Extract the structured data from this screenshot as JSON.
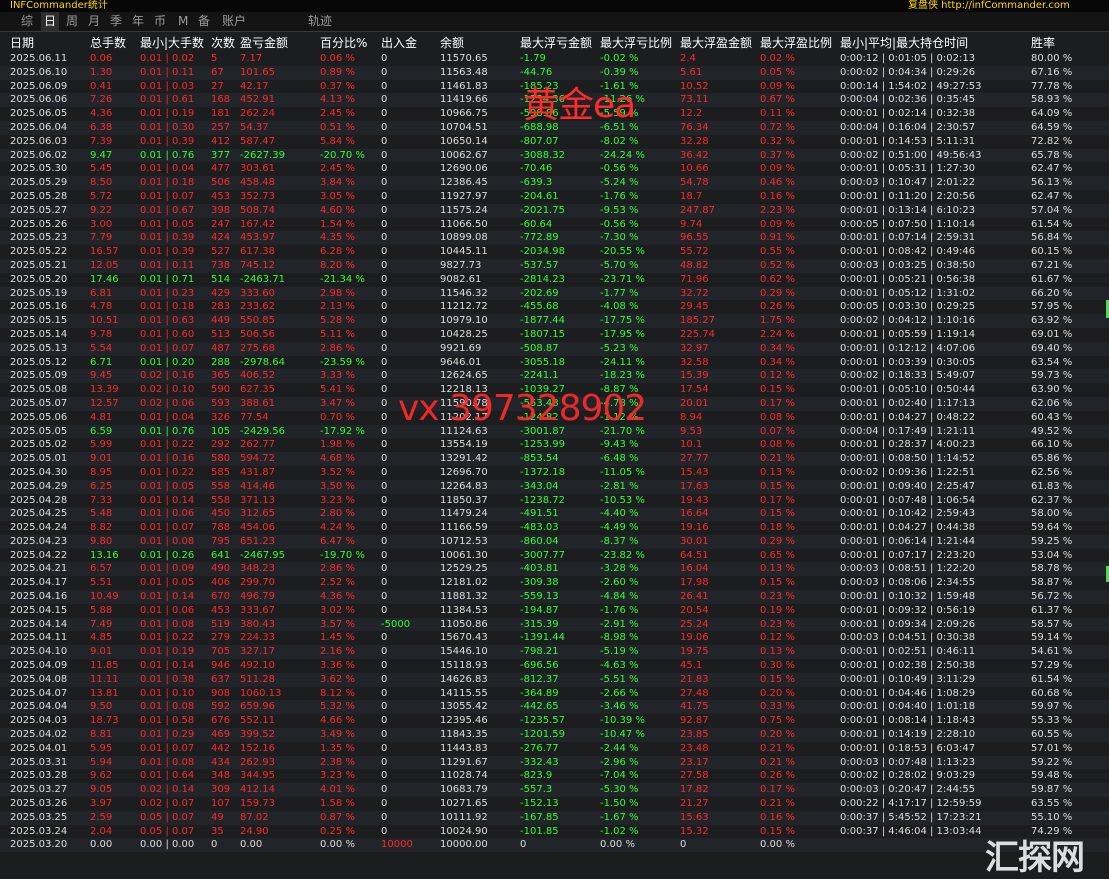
{
  "titlebar": {
    "left": "INFCommander统计",
    "right": "复盘侠 http://infCommander.com"
  },
  "tabs": [
    "综",
    "日",
    "周",
    "月",
    "季",
    "年",
    "币",
    "M",
    "备",
    "账户",
    "轨迹"
  ],
  "active_tab": "日",
  "headers": [
    "日期",
    "总手数",
    "最小|大手数",
    "次数",
    "盈亏金额",
    "百分比%",
    "出入金",
    "余额",
    "最大浮亏金额",
    "最大浮亏比例",
    "最大浮盈金额",
    "最大浮盈比例",
    "最小|平均|最大持仓时间",
    "胜率"
  ],
  "watermarks": {
    "gold": "黄金ea",
    "contact": "vx 397328902",
    "site": "汇探网"
  },
  "rows": [
    [
      "2025.06.11",
      "0.06",
      "0.01 | 0.02",
      "5",
      "7.17",
      "0.06 %",
      "0",
      "11570.65",
      "-1.79",
      "-0.02 %",
      "2.4",
      "0.02 %",
      "0:00:12 | 0:01:05 | 0:02:13",
      "80.00 %"
    ],
    [
      "2025.06.10",
      "1.30",
      "0.01 | 0.11",
      "67",
      "101.65",
      "0.89 %",
      "0",
      "11563.48",
      "-44.76",
      "-0.39 %",
      "5.61",
      "0.05 %",
      "0:00:02 | 0:04:34 | 0:29:26",
      "67.16 %"
    ],
    [
      "2025.06.09",
      "0.41",
      "0.01 | 0.03",
      "27",
      "42.17",
      "0.37 %",
      "0",
      "11461.83",
      "-185.23",
      "-1.61 %",
      "10.52",
      "0.09 %",
      "0:00:14 | 1:54:02 | 49:27:53",
      "77.78 %"
    ],
    [
      "2025.06.06",
      "7.26",
      "0.01 | 0.61",
      "168",
      "452.91",
      "4.13 %",
      "0",
      "11419.66",
      "-1234.36",
      "-11.26 %",
      "73.11",
      "0.67 %",
      "0:00:04 | 0:02:36 | 0:35:45",
      "58.93 %"
    ],
    [
      "2025.06.05",
      "4.36",
      "0.01 | 0.19",
      "181",
      "262.24",
      "2.45 %",
      "0",
      "10966.75",
      "-598.86",
      "-5.59 %",
      "12.2",
      "0.11 %",
      "0:00:01 | 0:02:14 | 0:32:38",
      "64.09 %"
    ],
    [
      "2025.06.04",
      "6.38",
      "0.01 | 0.30",
      "257",
      "54.37",
      "0.51 %",
      "0",
      "10704.51",
      "-688.98",
      "-6.51 %",
      "76.34",
      "0.72 %",
      "0:00:04 | 0:16:04 | 2:30:57",
      "64.59 %"
    ],
    [
      "2025.06.03",
      "7.39",
      "0.01 | 0.39",
      "412",
      "587.47",
      "5.84 %",
      "0",
      "10650.14",
      "-807.07",
      "-8.02 %",
      "32.28",
      "0.32 %",
      "0:00:01 | 0:14:53 | 5:11:31",
      "72.82 %"
    ],
    [
      "2025.06.02",
      "9.47",
      "0.01 | 0.76",
      "377",
      "-2627.39",
      "-20.70 %",
      "0",
      "10062.67",
      "-3088.32",
      "-24.24 %",
      "36.42",
      "0.37 %",
      "0:00:02 | 0:51:00 | 49:56:43",
      "65.78 %"
    ],
    [
      "2025.05.30",
      "5.45",
      "0.01 | 0.04",
      "477",
      "303.61",
      "2.45 %",
      "0",
      "12690.06",
      "-70.46",
      "-0.56 %",
      "10.66",
      "0.09 %",
      "0:00:01 | 0:05:31 | 1:27:30",
      "62.47 %"
    ],
    [
      "2025.05.29",
      "8.50",
      "0.01 | 0.18",
      "506",
      "458.48",
      "3.84 %",
      "0",
      "12386.45",
      "-639.3",
      "-5.24 %",
      "54.78",
      "0.46 %",
      "0:00:03 | 0:10:47 | 2:01:22",
      "56.13 %"
    ],
    [
      "2025.05.28",
      "5.72",
      "0.01 | 0.07",
      "453",
      "352.73",
      "3.05 %",
      "0",
      "11927.97",
      "-204.61",
      "-1.76 %",
      "18.7",
      "0.16 %",
      "0:00:01 | 0:11:20 | 2:20:56",
      "62.47 %"
    ],
    [
      "2025.05.27",
      "9.22",
      "0.01 | 0.67",
      "398",
      "508.74",
      "4.60 %",
      "0",
      "11575.24",
      "-2021.75",
      "-9.53 %",
      "247.87",
      "2.23 %",
      "0:00:01 | 0:13:14 | 6:10:23",
      "57.04 %"
    ],
    [
      "2025.05.26",
      "3.00",
      "0.01 | 0.05",
      "247",
      "167.42",
      "1.54 %",
      "0",
      "11066.50",
      "-60.64",
      "-0.56 %",
      "9.74",
      "0.09 %",
      "0:00:05 | 0:07:50 | 1:10:14",
      "61.54 %"
    ],
    [
      "2025.05.23",
      "7.79",
      "0.01 | 0.39",
      "424",
      "453.97",
      "4.35 %",
      "0",
      "10899.08",
      "-772.89",
      "-7.30 %",
      "96.55",
      "0.91 %",
      "0:00:01 | 0:07:14 | 2:59:31",
      "56.84 %"
    ],
    [
      "2025.05.22",
      "16.57",
      "0.01 | 0.39",
      "527",
      "617.38",
      "6.28 %",
      "0",
      "10445.11",
      "-2034.98",
      "-20.55 %",
      "55.72",
      "0.55 %",
      "0:00:01 | 0:08:42 | 0:49:46",
      "60.15 %"
    ],
    [
      "2025.05.21",
      "12.05",
      "0.01 | 0.11",
      "738",
      "745.12",
      "8.20 %",
      "0",
      "9827.73",
      "-537.57",
      "-5.70 %",
      "48.82",
      "0.52 %",
      "0:00:03 | 0:03:25 | 0:38:50",
      "67.21 %"
    ],
    [
      "2025.05.20",
      "17.46",
      "0.01 | 0.71",
      "514",
      "-2463.71",
      "-21.34 %",
      "0",
      "9082.61",
      "-2814.23",
      "-23.71 %",
      "71.96",
      "0.62 %",
      "0:00:01 | 0:05:21 | 0:56:38",
      "61.67 %"
    ],
    [
      "2025.05.19",
      "6.81",
      "0.01 | 0.23",
      "429",
      "333.60",
      "2.98 %",
      "0",
      "11546.32",
      "-202.69",
      "-1.77 %",
      "32.72",
      "0.29 %",
      "0:00:01 | 0:05:12 | 1:31:02",
      "66.20 %"
    ],
    [
      "2025.05.16",
      "4.78",
      "0.01 | 0.18",
      "283",
      "233.62",
      "2.13 %",
      "0",
      "11212.72",
      "-455.68",
      "-4.08 %",
      "29.45",
      "0.26 %",
      "0:00:05 | 0:03:30 | 0:29:25",
      "57.95 %"
    ],
    [
      "2025.05.15",
      "10.51",
      "0.01 | 0.63",
      "449",
      "550.85",
      "5.28 %",
      "0",
      "10979.10",
      "-1877.44",
      "-17.75 %",
      "185.27",
      "1.75 %",
      "0:00:02 | 0:04:12 | 1:10:16",
      "63.92 %"
    ],
    [
      "2025.05.14",
      "9.78",
      "0.01 | 0.60",
      "513",
      "506.56",
      "5.11 %",
      "0",
      "10428.25",
      "-1807.15",
      "-17.95 %",
      "225.74",
      "2.24 %",
      "0:00:01 | 0:05:59 | 1:19:14",
      "69.01 %"
    ],
    [
      "2025.05.13",
      "5.54",
      "0.01 | 0.07",
      "487",
      "275.68",
      "2.86 %",
      "0",
      "9921.69",
      "-508.87",
      "-5.23 %",
      "32.97",
      "0.34 %",
      "0:00:01 | 0:12:12 | 4:07:06",
      "69.40 %"
    ],
    [
      "2025.05.12",
      "6.71",
      "0.01 | 0.20",
      "288",
      "-2978.64",
      "-23.59 %",
      "0",
      "9646.01",
      "-3055.18",
      "-24.11 %",
      "32.58",
      "0.34 %",
      "0:00:01 | 0:03:39 | 0:30:05",
      "63.54 %"
    ],
    [
      "2025.05.09",
      "9.45",
      "0.02 | 0.16",
      "365",
      "406.52",
      "3.33 %",
      "0",
      "12624.65",
      "-2241.1",
      "-18.23 %",
      "15.39",
      "0.12 %",
      "0:00:02 | 0:18:33 | 5:49:07",
      "59.73 %"
    ],
    [
      "2025.05.08",
      "13.39",
      "0.02 | 0.10",
      "590",
      "627.35",
      "5.41 %",
      "0",
      "12218.13",
      "-1039.27",
      "-8.87 %",
      "17.54",
      "0.15 %",
      "0:00:01 | 0:05:10 | 0:50:44",
      "63.90 %"
    ],
    [
      "2025.05.07",
      "12.57",
      "0.02 | 0.06",
      "593",
      "388.61",
      "3.47 %",
      "0",
      "11590.78",
      "-553.48",
      "-4.78 %",
      "20.01",
      "0.17 %",
      "0:00:01 | 0:02:40 | 1:17:13",
      "62.06 %"
    ],
    [
      "2025.05.06",
      "4.81",
      "0.01 | 0.04",
      "326",
      "77.54",
      "0.70 %",
      "0",
      "11202.17",
      "-124.82",
      "-1.12 %",
      "8.94",
      "0.08 %",
      "0:00:01 | 0:04:27 | 0:48:22",
      "60.43 %"
    ],
    [
      "2025.05.05",
      "6.59",
      "0.01 | 0.76",
      "105",
      "-2429.56",
      "-17.92 %",
      "0",
      "11124.63",
      "-3001.87",
      "-21.70 %",
      "9.53",
      "0.07 %",
      "0:00:04 | 0:17:49 | 1:21:11",
      "49.52 %"
    ],
    [
      "2025.05.02",
      "5.99",
      "0.01 | 0.22",
      "292",
      "262.77",
      "1.98 %",
      "0",
      "13554.19",
      "-1253.99",
      "-9.43 %",
      "10.1",
      "0.08 %",
      "0:00:01 | 0:28:37 | 4:00:23",
      "66.10 %"
    ],
    [
      "2025.05.01",
      "9.01",
      "0.01 | 0.16",
      "580",
      "594.72",
      "4.68 %",
      "0",
      "13291.42",
      "-853.54",
      "-6.48 %",
      "27.77",
      "0.21 %",
      "0:00:01 | 0:08:50 | 1:14:52",
      "65.86 %"
    ],
    [
      "2025.04.30",
      "8.95",
      "0.01 | 0.22",
      "585",
      "431.87",
      "3.52 %",
      "0",
      "12696.70",
      "-1372.18",
      "-11.05 %",
      "15.43",
      "0.13 %",
      "0:00:02 | 0:09:36 | 1:22:51",
      "62.56 %"
    ],
    [
      "2025.04.29",
      "6.25",
      "0.01 | 0.05",
      "558",
      "414.46",
      "3.50 %",
      "0",
      "12264.83",
      "-343.04",
      "-2.81 %",
      "17.63",
      "0.15 %",
      "0:00:01 | 0:09:40 | 2:25:47",
      "61.83 %"
    ],
    [
      "2025.04.28",
      "7.33",
      "0.01 | 0.14",
      "558",
      "371.13",
      "3.23 %",
      "0",
      "11850.37",
      "-1238.72",
      "-10.53 %",
      "19.43",
      "0.17 %",
      "0:00:01 | 0:07:48 | 1:06:54",
      "62.37 %"
    ],
    [
      "2025.04.25",
      "5.48",
      "0.01 | 0.06",
      "450",
      "312.65",
      "2.80 %",
      "0",
      "11479.24",
      "-491.51",
      "-4.40 %",
      "16.64",
      "0.15 %",
      "0:00:01 | 0:10:42 | 2:59:43",
      "58.00 %"
    ],
    [
      "2025.04.24",
      "8.82",
      "0.01 | 0.07",
      "788",
      "454.06",
      "4.24 %",
      "0",
      "11166.59",
      "-483.03",
      "-4.49 %",
      "19.16",
      "0.18 %",
      "0:00:01 | 0:04:27 | 0:44:38",
      "59.64 %"
    ],
    [
      "2025.04.23",
      "9.80",
      "0.01 | 0.08",
      "795",
      "651.23",
      "6.47 %",
      "0",
      "10712.53",
      "-860.04",
      "-8.37 %",
      "30.01",
      "0.29 %",
      "0:00:01 | 0:06:14 | 1:21:44",
      "59.25 %"
    ],
    [
      "2025.04.22",
      "13.16",
      "0.01 | 0.26",
      "641",
      "-2467.95",
      "-19.70 %",
      "0",
      "10061.30",
      "-3007.77",
      "-23.82 %",
      "64.51",
      "0.65 %",
      "0:00:01 | 0:07:17 | 2:23:20",
      "53.04 %"
    ],
    [
      "2025.04.21",
      "6.57",
      "0.01 | 0.09",
      "490",
      "348.23",
      "2.86 %",
      "0",
      "12529.25",
      "-403.81",
      "-3.28 %",
      "16.04",
      "0.13 %",
      "0:00:03 | 0:08:51 | 1:22:20",
      "58.78 %"
    ],
    [
      "2025.04.17",
      "5.51",
      "0.01 | 0.05",
      "406",
      "299.70",
      "2.52 %",
      "0",
      "12181.02",
      "-309.38",
      "-2.60 %",
      "17.98",
      "0.15 %",
      "0:00:03 | 0:08:06 | 2:34:55",
      "58.87 %"
    ],
    [
      "2025.04.16",
      "10.49",
      "0.01 | 0.14",
      "670",
      "496.79",
      "4.36 %",
      "0",
      "11881.32",
      "-559.13",
      "-4.84 %",
      "26.41",
      "0.23 %",
      "0:00:01 | 0:10:32 | 1:59:48",
      "56.72 %"
    ],
    [
      "2025.04.15",
      "5.88",
      "0.01 | 0.06",
      "453",
      "333.67",
      "3.02 %",
      "0",
      "11384.53",
      "-194.87",
      "-1.76 %",
      "20.54",
      "0.19 %",
      "0:00:01 | 0:09:32 | 0:56:19",
      "61.37 %"
    ],
    [
      "2025.04.14",
      "7.49",
      "0.01 | 0.08",
      "519",
      "380.43",
      "3.57 %",
      "-5000",
      "11050.86",
      "-315.39",
      "-2.91 %",
      "25.24",
      "0.23 %",
      "0:00:01 | 0:09:34 | 2:09:26",
      "58.57 %"
    ],
    [
      "2025.04.11",
      "4.85",
      "0.01 | 0.22",
      "279",
      "224.33",
      "1.45 %",
      "0",
      "15670.43",
      "-1391.44",
      "-8.98 %",
      "19.06",
      "0.12 %",
      "0:00:03 | 0:04:51 | 0:30:38",
      "59.14 %"
    ],
    [
      "2025.04.10",
      "9.01",
      "0.01 | 0.19",
      "705",
      "327.17",
      "2.16 %",
      "0",
      "15446.10",
      "-798.21",
      "-5.19 %",
      "19.75",
      "0.13 %",
      "0:00:01 | 0:02:51 | 0:46:11",
      "54.61 %"
    ],
    [
      "2025.04.09",
      "11.85",
      "0.01 | 0.14",
      "946",
      "492.10",
      "3.36 %",
      "0",
      "15118.93",
      "-696.56",
      "-4.63 %",
      "45.1",
      "0.30 %",
      "0:00:01 | 0:02:38 | 2:50:38",
      "57.29 %"
    ],
    [
      "2025.04.08",
      "11.11",
      "0.01 | 0.38",
      "637",
      "511.28",
      "3.62 %",
      "0",
      "14626.83",
      "-812.37",
      "-5.51 %",
      "21.83",
      "0.15 %",
      "0:00:01 | 0:10:49 | 3:11:29",
      "61.54 %"
    ],
    [
      "2025.04.07",
      "13.81",
      "0.01 | 0.10",
      "908",
      "1060.13",
      "8.12 %",
      "0",
      "14115.55",
      "-364.89",
      "-2.66 %",
      "27.48",
      "0.20 %",
      "0:00:01 | 0:04:46 | 1:08:29",
      "60.68 %"
    ],
    [
      "2025.04.04",
      "9.50",
      "0.01 | 0.08",
      "592",
      "659.96",
      "5.32 %",
      "0",
      "13055.42",
      "-442.65",
      "-3.46 %",
      "41.75",
      "0.33 %",
      "0:00:01 | 0:04:40 | 1:01:18",
      "59.97 %"
    ],
    [
      "2025.04.03",
      "18.73",
      "0.01 | 0.58",
      "676",
      "552.11",
      "4.66 %",
      "0",
      "12395.46",
      "-1235.57",
      "-10.39 %",
      "92.87",
      "0.75 %",
      "0:00:01 | 0:08:14 | 1:18:43",
      "55.33 %"
    ],
    [
      "2025.04.02",
      "8.81",
      "0.01 | 0.29",
      "469",
      "399.52",
      "3.49 %",
      "0",
      "11843.35",
      "-1201.59",
      "-10.47 %",
      "23.85",
      "0.20 %",
      "0:00:01 | 0:14:19 | 2:28:10",
      "60.55 %"
    ],
    [
      "2025.04.01",
      "5.95",
      "0.01 | 0.07",
      "442",
      "152.16",
      "1.35 %",
      "0",
      "11443.83",
      "-276.77",
      "-2.44 %",
      "23.48",
      "0.21 %",
      "0:00:01 | 0:18:53 | 6:03:47",
      "57.01 %"
    ],
    [
      "2025.03.31",
      "5.94",
      "0.01 | 0.08",
      "434",
      "262.93",
      "2.38 %",
      "0",
      "11291.67",
      "-332.43",
      "-2.96 %",
      "23.17",
      "0.21 %",
      "0:00:03 | 0:07:48 | 1:13:23",
      "59.22 %"
    ],
    [
      "2025.03.28",
      "9.62",
      "0.01 | 0.64",
      "348",
      "344.95",
      "3.23 %",
      "0",
      "11028.74",
      "-823.9",
      "-7.04 %",
      "27.58",
      "0.26 %",
      "0:00:02 | 0:28:02 | 9:03:29",
      "59.48 %"
    ],
    [
      "2025.03.27",
      "9.05",
      "0.02 | 0.14",
      "309",
      "412.14",
      "4.01 %",
      "0",
      "10683.79",
      "-557.3",
      "-5.30 %",
      "17.82",
      "0.17 %",
      "0:00:03 | 0:20:47 | 2:44:55",
      "59.87 %"
    ],
    [
      "2025.03.26",
      "3.97",
      "0.02 | 0.07",
      "107",
      "159.73",
      "1.58 %",
      "0",
      "10271.65",
      "-152.13",
      "-1.50 %",
      "21.27",
      "0.21 %",
      "0:00:22 | 4:17:17 | 12:59:59",
      "63.55 %"
    ],
    [
      "2025.03.25",
      "2.59",
      "0.05 | 0.07",
      "49",
      "87.02",
      "0.87 %",
      "0",
      "10111.92",
      "-167.85",
      "-1.67 %",
      "15.63",
      "0.16 %",
      "0:00:37 | 5:45:52 | 17:23:21",
      "55.10 %"
    ],
    [
      "2025.03.24",
      "2.04",
      "0.05 | 0.07",
      "35",
      "24.90",
      "0.25 %",
      "0",
      "10024.90",
      "-101.85",
      "-1.02 %",
      "15.32",
      "0.15 %",
      "0:00:37 | 4:46:04 | 13:03:44",
      "74.29 %"
    ],
    [
      "2025.03.20",
      "0.00",
      "0.00 | 0.00",
      "0",
      "0.00",
      "0.00 %",
      "10000",
      "10000.00",
      "0",
      "0.00 %",
      "0",
      "0.00 %",
      "",
      ""
    ]
  ]
}
